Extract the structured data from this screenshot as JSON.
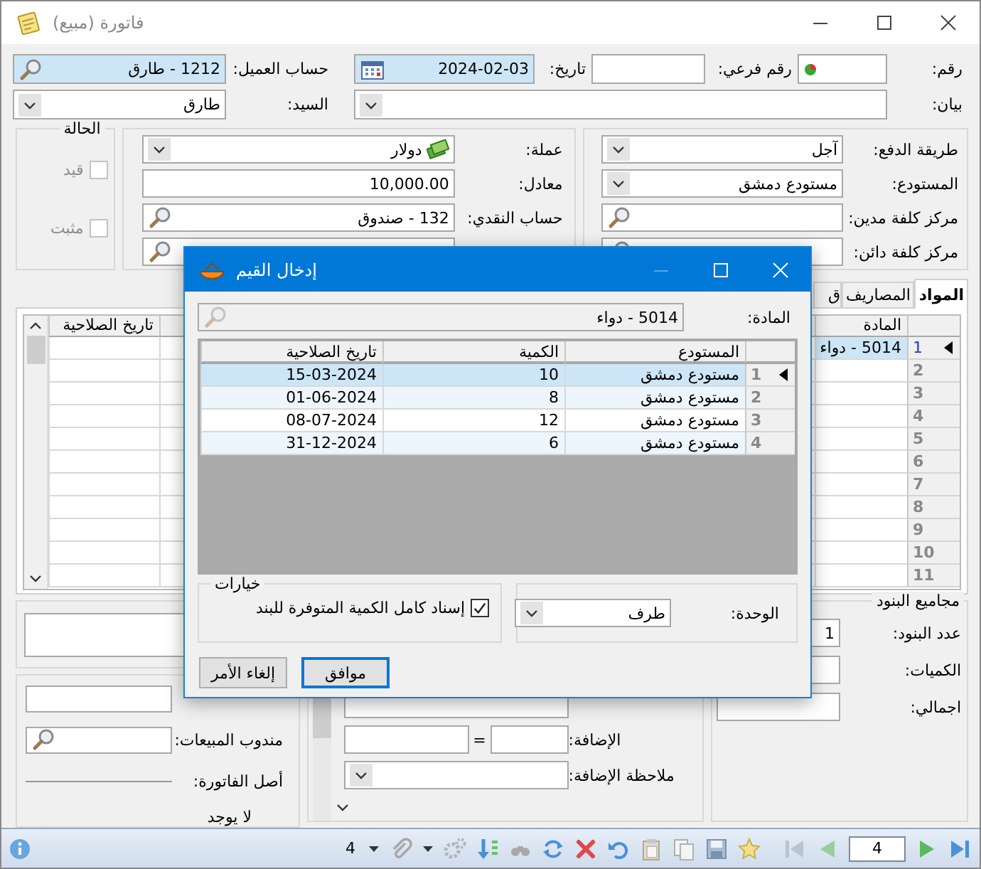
{
  "window": {
    "title": "فاتورة (مبيع)"
  },
  "header_rows": [
    [
      {
        "kind": "coded",
        "label": "رقم:",
        "highlighted": false
      },
      {
        "kind": "text",
        "label": "رقم فرعي:",
        "highlighted": false
      },
      {
        "kind": "date",
        "label": "تاريخ:",
        "value": "2024-02-03",
        "highlighted": true
      },
      {
        "kind": "search",
        "label": "حساب العميل:",
        "value": "1212 - طارق",
        "highlighted": true
      }
    ],
    [
      {
        "kind": "dropdown",
        "label": "بيان:",
        "highlighted": false
      },
      {
        "kind": "dropdown",
        "label": "السيد:",
        "value": "طارق",
        "highlighted": false
      }
    ]
  ],
  "payment_panel": [
    {
      "kind": "dropdown",
      "label": "طريقة الدفع:",
      "value": "آجل"
    },
    {
      "kind": "dropdown",
      "label": "المستودع:",
      "value": "مستودع دمشق"
    },
    {
      "kind": "search",
      "label": "مركز كلفة مدين:"
    },
    {
      "kind": "search",
      "label": "مركز كلفة دائن:"
    }
  ],
  "currency_panel": [
    {
      "kind": "dropdown",
      "label": "عملة:",
      "value": "دولار"
    },
    {
      "kind": "text",
      "label": "معادل:",
      "value": "10,000.00"
    },
    {
      "kind": "search",
      "label": "حساب النقدي:",
      "value": "132 - صندوق"
    },
    {
      "kind": "search"
    }
  ],
  "status_panel": {
    "title": "الحالة",
    "checks": [
      {
        "label": "قيد",
        "checked": false,
        "disabled": true
      },
      {
        "label": "مثبت",
        "checked": false,
        "disabled": true
      }
    ]
  },
  "tabs": [
    {
      "label": "المواد",
      "selected": true
    },
    {
      "label": "المصاريف",
      "selected": false
    },
    {
      "label": "ق",
      "selected": false
    }
  ],
  "items_grid": {
    "columns": [
      {
        "label": "المادة"
      },
      {
        "label": "تاريخ الصلاحية"
      }
    ],
    "rows": [
      {
        "number": "1",
        "material": "5014 - دواء",
        "selected": true
      },
      {
        "number": "2",
        "selected": false
      },
      {
        "number": "3",
        "selected": false
      },
      {
        "number": "4",
        "selected": false
      },
      {
        "number": "5",
        "selected": false
      },
      {
        "number": "6",
        "selected": false
      },
      {
        "number": "7",
        "selected": false
      },
      {
        "number": "8",
        "selected": false
      },
      {
        "number": "9",
        "selected": false
      },
      {
        "number": "10",
        "selected": false
      },
      {
        "number": "11",
        "selected": false
      }
    ]
  },
  "totals_panel": {
    "title": "مجاميع البنود",
    "fields": [
      {
        "kind": "text",
        "label": "عدد البنود:",
        "value": "1"
      },
      {
        "kind": "text",
        "label": "الكميات:"
      },
      {
        "kind": "text",
        "label": "اجمالي:"
      }
    ]
  },
  "addition_panel": {
    "fields": [
      {
        "kind": "text"
      },
      {
        "kind": "pair",
        "label": "الإضافة:",
        "separator": "="
      },
      {
        "kind": "dropdown",
        "label": "ملاحظة الإضافة:"
      }
    ]
  },
  "notes_panel": {
    "fields": [
      {
        "kind": "memo"
      }
    ]
  },
  "sales_panel": {
    "fields": [
      {
        "kind": "text"
      },
      {
        "kind": "search",
        "label": "مندوب المبيعات:"
      }
    ],
    "origin": {
      "label": "أصل الفاتورة:",
      "value": "لا يوجد"
    }
  },
  "status_bar": {
    "record": "4",
    "attachments": "4"
  },
  "dialog": {
    "title": "إدخال القيم",
    "material": {
      "kind": "search",
      "label": "المادة:",
      "value": "5014 - دواء",
      "disabled": true
    },
    "grid": {
      "columns": [
        "المستودع",
        "الكمية",
        "تاريخ الصلاحية"
      ],
      "rows": [
        {
          "number": "1",
          "warehouse": "مستودع دمشق",
          "quantity": "10",
          "expiry": "15-03-2024",
          "selected": true
        },
        {
          "number": "2",
          "warehouse": "مستودع دمشق",
          "quantity": "8",
          "expiry": "01-06-2024",
          "selected": false
        },
        {
          "number": "3",
          "warehouse": "مستودع دمشق",
          "quantity": "12",
          "expiry": "08-07-2024",
          "selected": false
        },
        {
          "number": "4",
          "warehouse": "مستودع دمشق",
          "quantity": "6",
          "expiry": "31-12-2024",
          "selected": false
        }
      ]
    },
    "options": {
      "title": "خيارات",
      "checks": [
        {
          "label": "إسناد كامل الكمية المتوفرة للبند",
          "checked": true
        }
      ]
    },
    "unit": {
      "kind": "dropdown",
      "label": "الوحدة:",
      "value": "طرف"
    },
    "buttons": [
      {
        "label": "موافق",
        "default": true
      },
      {
        "label": "إلغاء الأمر",
        "default": false
      }
    ]
  }
}
